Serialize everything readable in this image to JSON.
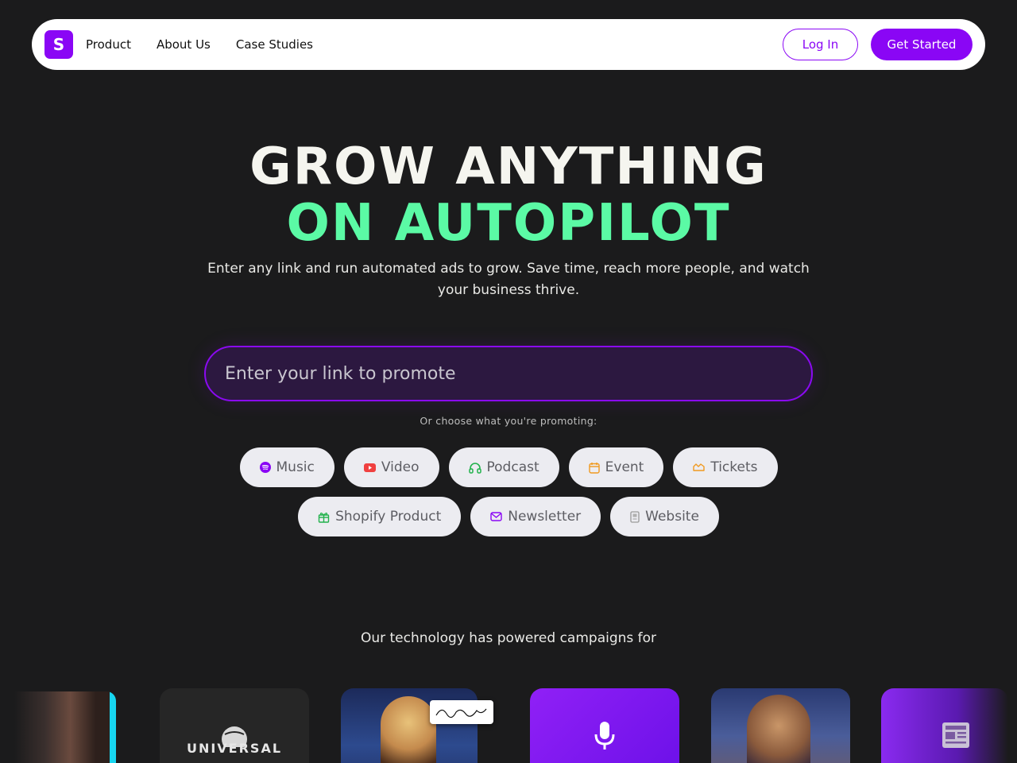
{
  "nav": {
    "logo_letter": "S",
    "links": [
      "Product",
      "About Us",
      "Case Studies"
    ],
    "login_label": "Log In",
    "get_started_label": "Get Started"
  },
  "hero": {
    "title_line1": "GROW ANYTHING",
    "title_line2": "ON AUTOPILOT",
    "subtitle": "Enter any link and run automated ads to grow. Save time, reach more people, and watch your business thrive.",
    "input_placeholder": "Enter your link to promote",
    "choose_label": "Or choose what you're promoting:"
  },
  "chips_row1": [
    {
      "label": "Music",
      "icon": "spotify-icon",
      "color": "#8a06f5"
    },
    {
      "label": "Video",
      "icon": "youtube-icon",
      "color": "#f04040"
    },
    {
      "label": "Podcast",
      "icon": "headphones-icon",
      "color": "#22b24c"
    },
    {
      "label": "Event",
      "icon": "calendar-icon",
      "color": "#f09a20"
    },
    {
      "label": "Tickets",
      "icon": "ticket-icon",
      "color": "#f09a20"
    }
  ],
  "chips_row2": [
    {
      "label": "Shopify Product",
      "icon": "gift-icon",
      "color": "#22b24c"
    },
    {
      "label": "Newsletter",
      "icon": "mail-icon",
      "color": "#8a06f5"
    },
    {
      "label": "Website",
      "icon": "page-icon",
      "color": "#9a9a9a"
    }
  ],
  "powered_label": "Our technology has powered campaigns for",
  "carousel": {
    "universal_text": "UNIVERSAL"
  },
  "colors": {
    "accent": "#8a06f5",
    "green": "#5bfaa5",
    "background": "#1b1b1c"
  }
}
